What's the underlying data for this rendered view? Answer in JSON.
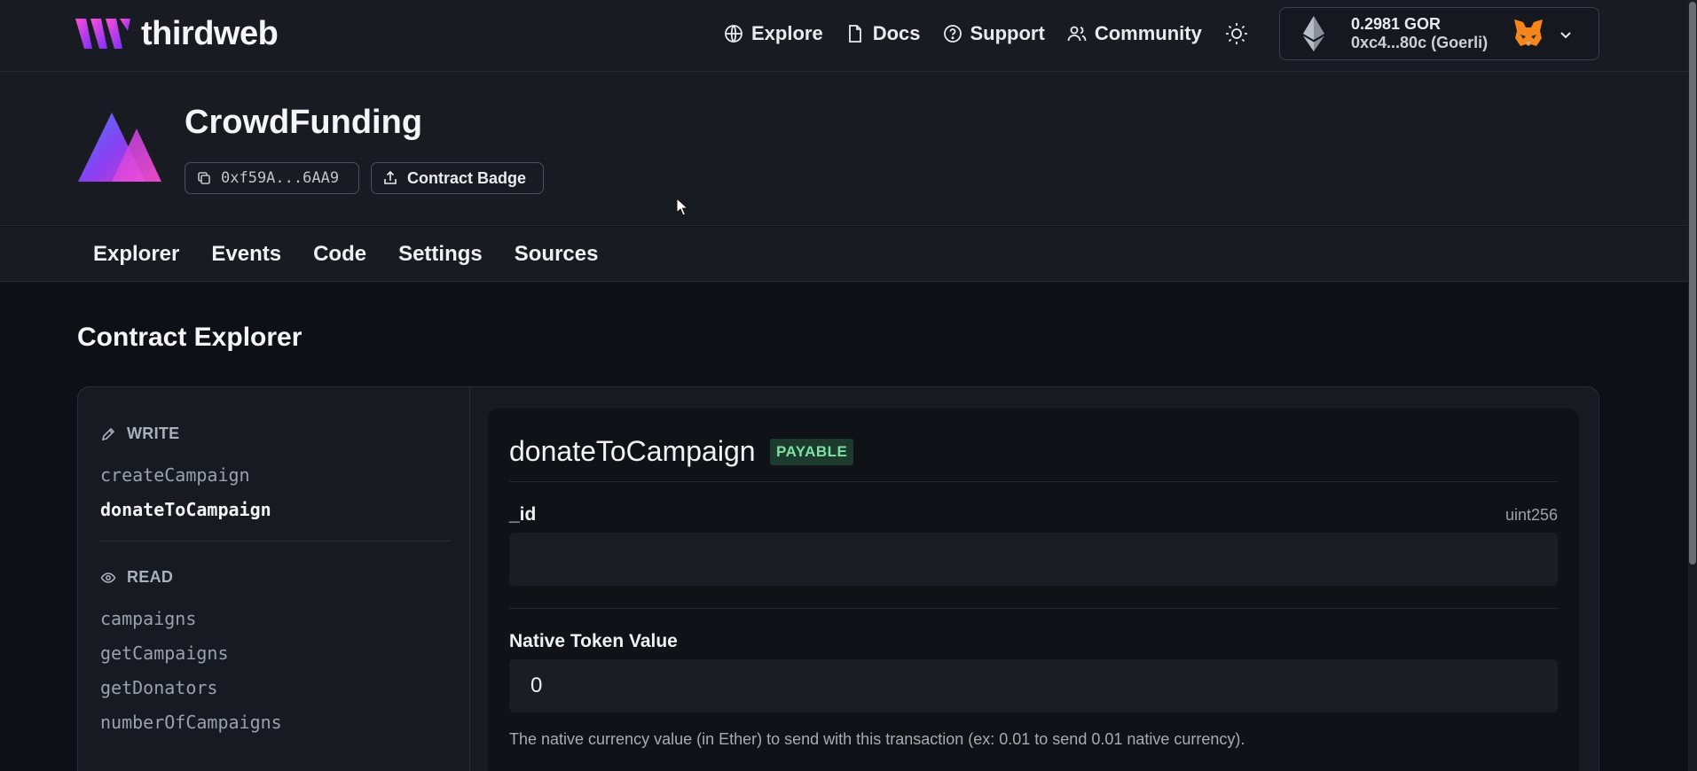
{
  "brand": {
    "name": "thirdweb"
  },
  "nav": {
    "items": [
      {
        "label": "Explore",
        "icon": "globe-icon"
      },
      {
        "label": "Docs",
        "icon": "document-icon"
      },
      {
        "label": "Support",
        "icon": "help-circle-icon"
      },
      {
        "label": "Community",
        "icon": "users-icon"
      }
    ],
    "theme_icon": "sun-icon"
  },
  "wallet": {
    "balance": "0.2981 GOR",
    "address": "0xc4...80c (Goerli)",
    "network_icon": "ethereum-icon",
    "wallet_icon": "metamask-fox-icon"
  },
  "contract": {
    "name": "CrowdFunding",
    "address": "0xf59A...6AA9",
    "badge_label": "Contract Badge"
  },
  "tabs": [
    {
      "label": "Explorer"
    },
    {
      "label": "Events"
    },
    {
      "label": "Code"
    },
    {
      "label": "Settings"
    },
    {
      "label": "Sources"
    }
  ],
  "explorer": {
    "title": "Contract Explorer",
    "write": {
      "heading": "WRITE",
      "functions": [
        "createCampaign",
        "donateToCampaign"
      ],
      "active": "donateToCampaign"
    },
    "read": {
      "heading": "READ",
      "functions": [
        "campaigns",
        "getCampaigns",
        "getDonators",
        "numberOfCampaigns"
      ]
    },
    "form": {
      "function_name": "donateToCampaign",
      "badge": "PAYABLE",
      "param_name": "_id",
      "param_type": "uint256",
      "param_value": "",
      "native_label": "Native Token Value",
      "native_value": "0",
      "native_help": "The native currency value (in Ether) to send with this transaction (ex: 0.01 to send 0.01 native currency)."
    }
  },
  "colors": {
    "background": "#0d1117",
    "header_bg": "#181c22",
    "payable_bg": "#1c3b2c",
    "payable_text": "#7ee0a5",
    "brand_gradient": [
      "#ff4fd8",
      "#7b2ff7"
    ]
  }
}
